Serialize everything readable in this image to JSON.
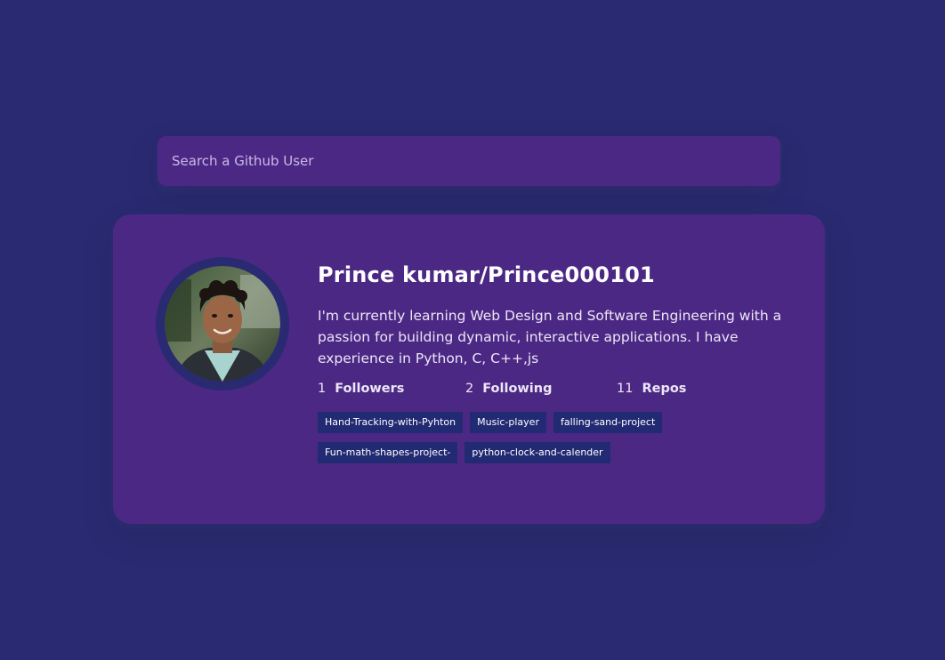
{
  "search": {
    "placeholder": "Search a Github User",
    "value": ""
  },
  "user": {
    "name": "Prince kumar/Prince000101",
    "bio": "I'm currently learning Web Design and Software Engineering with a passion for building dynamic, interactive applications. I have experience in Python, C, C++,js",
    "avatar_alt": "Prince kumar/Prince000101"
  },
  "stats": {
    "followers": {
      "count": "1",
      "label": "Followers"
    },
    "following": {
      "count": "2",
      "label": "Following"
    },
    "repos": {
      "count": "11",
      "label": "Repos"
    }
  },
  "repos": [
    "Hand-Tracking-with-Pyhton",
    "Music-player",
    "falling-sand-project",
    "Fun-math-shapes-project-",
    "python-clock-and-calender"
  ],
  "colors": {
    "background": "#2a2a72",
    "card": "#4c2885",
    "repo_chip": "#212a72",
    "text": "#ffffff"
  }
}
